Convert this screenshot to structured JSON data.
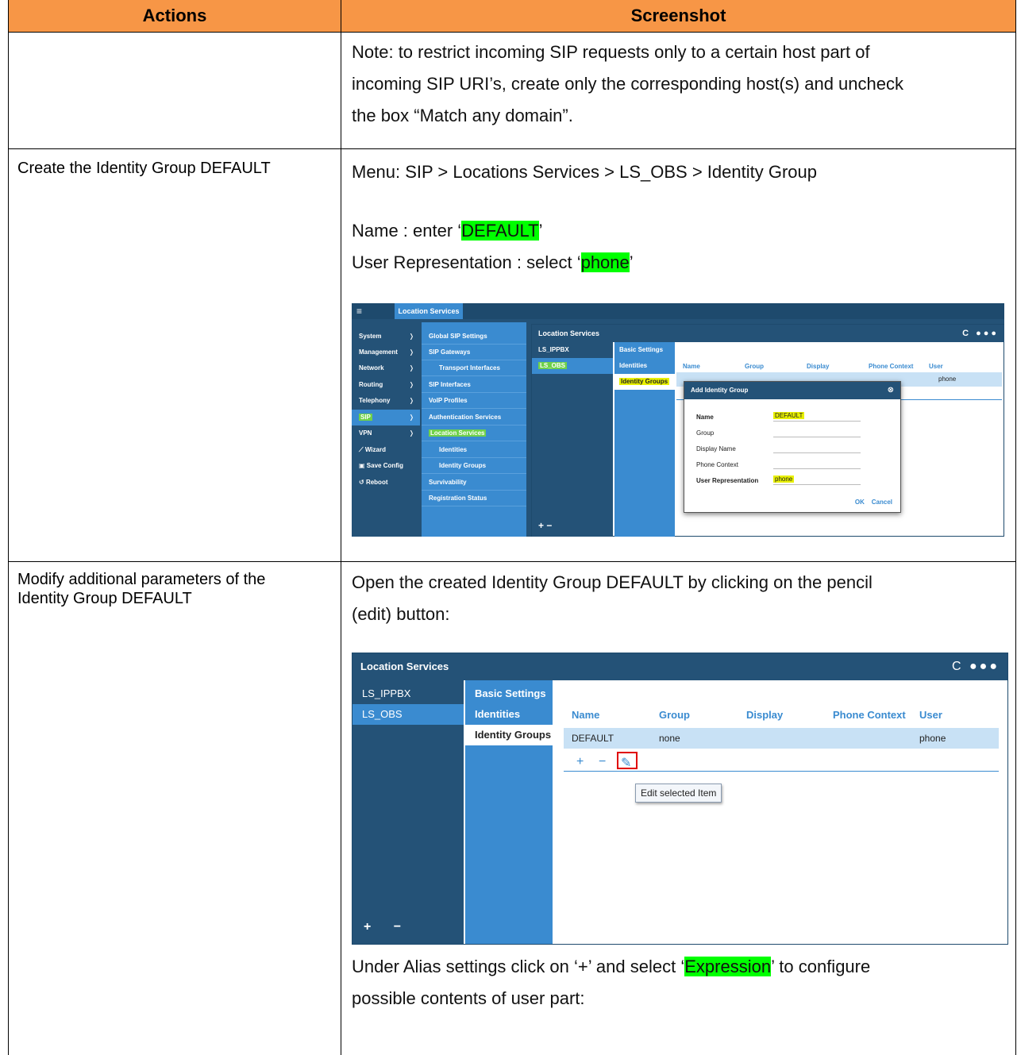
{
  "table": {
    "header_actions": "Actions",
    "header_screenshot": "Screenshot"
  },
  "row1": {
    "note_line1": "Note: to restrict incoming SIP requests only to a certain host part of",
    "note_line2": "incoming SIP URI’s, create only the corresponding host(s) and uncheck",
    "note_line3": "the box “Match any domain”."
  },
  "row2": {
    "action": "Create the Identity Group DEFAULT",
    "menu_path": "Menu: SIP > Locations Services > LS_OBS > Identity Group",
    "name_prefix": "Name : enter ‘",
    "name_value": "DEFAULT",
    "name_suffix": "’",
    "userrep_prefix": "User Representation : select ‘",
    "userrep_value": "phone",
    "userrep_suffix": "’"
  },
  "screenshot1": {
    "tab": "Location Services",
    "left_menu": [
      "System",
      "Management",
      "Network",
      "Routing",
      "Telephony",
      "SIP",
      "VPN",
      "Wizard",
      "Save Config",
      "Reboot"
    ],
    "mid_menu": [
      "Global SIP Settings",
      "SIP Gateways",
      "Transport Interfaces",
      "SIP Interfaces",
      "VoIP Profiles",
      "Authentication Services",
      "Location Services",
      "Identities",
      "Identity Groups",
      "Survivability",
      "Registration Status"
    ],
    "window_title": "Location Services",
    "window_controls": "C ●●●",
    "services": [
      "LS_IPPBX",
      "LS_OBS"
    ],
    "settings": [
      "Basic Settings",
      "Identities",
      "Identity Groups"
    ],
    "columns": [
      "Name",
      "Group",
      "Display",
      "Phone Context",
      "User"
    ],
    "row_user": "phone",
    "plus_minus": "+ −",
    "dialog": {
      "title": "Add Identity Group",
      "close": "⊗",
      "fields": [
        "Name",
        "Group",
        "Display Name",
        "Phone Context",
        "User Representation"
      ],
      "name_value": "DEFAULT",
      "userrep_value": "phone",
      "ok": "OK",
      "cancel": "Cancel"
    }
  },
  "row3": {
    "action_line1": "Modify additional parameters of the",
    "action_line2": "Identity Group DEFAULT",
    "open_line1": "Open the created Identity Group DEFAULT by clicking on the pencil",
    "open_line2": "(edit) button:",
    "alias_prefix": "Under Alias settings click on ‘+’ and select ‘",
    "alias_value": "Expression",
    "alias_suffix": "’ to configure",
    "alias_line2": "possible contents of user part:"
  },
  "screenshot2": {
    "window_title": "Location Services",
    "window_controls": "C ●●●",
    "services": [
      "LS_IPPBX",
      "LS_OBS"
    ],
    "settings": [
      "Basic Settings",
      "Identities",
      "Identity Groups"
    ],
    "columns": [
      "Name",
      "Group",
      "Display",
      "Phone Context",
      "User"
    ],
    "row": {
      "name": "DEFAULT",
      "group": "none",
      "user": "phone"
    },
    "tool_plus": "+",
    "tool_minus": "−",
    "tool_edit": "✎",
    "left_plus_minus": "+ −",
    "tooltip": "Edit selected Item"
  },
  "colors": {
    "header_bg": "#f79646",
    "highlight": "#00ff00",
    "app_dark": "#245277",
    "app_accent": "#3a8bd0"
  }
}
